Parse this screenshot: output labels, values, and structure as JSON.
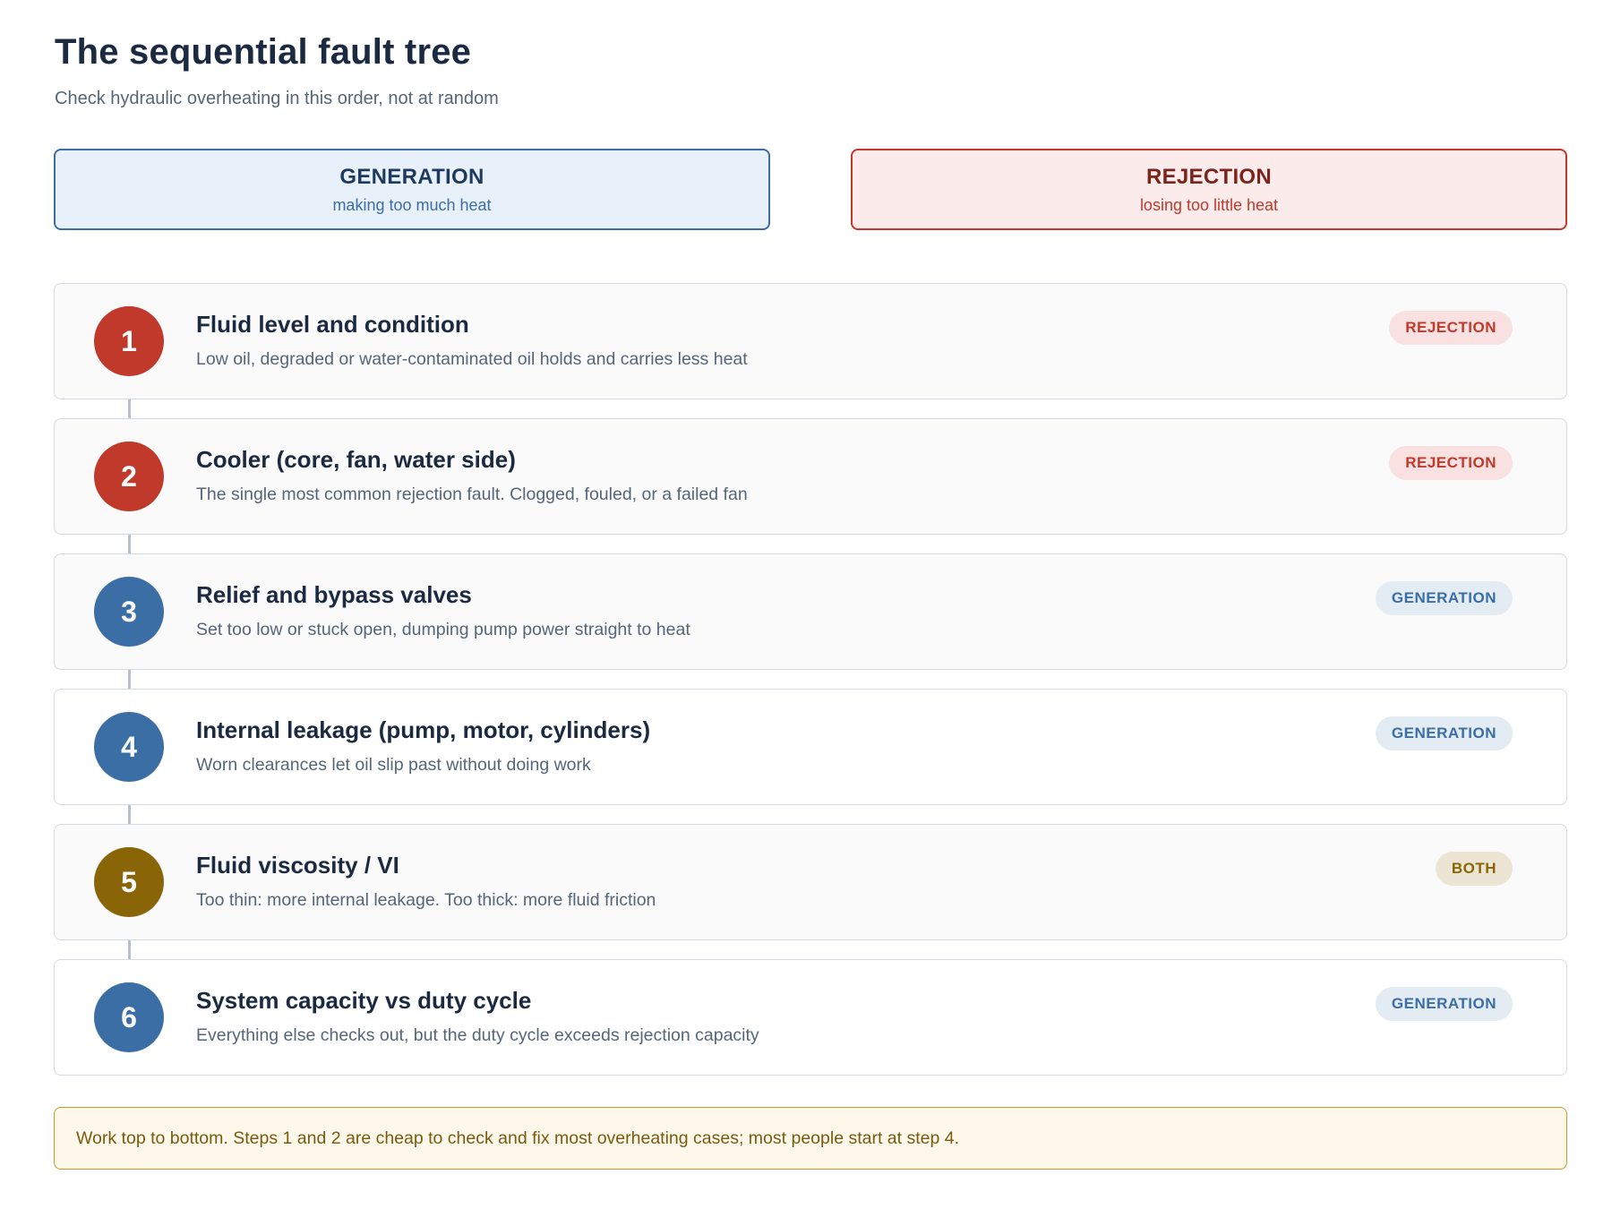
{
  "header": {
    "title": "The sequential fault tree",
    "subtitle": "Check hydraulic overheating in this order, not at random"
  },
  "legend": {
    "generation": {
      "title": "GENERATION",
      "subtitle": "making too much heat",
      "color": "#3a6ea5"
    },
    "rejection": {
      "title": "REJECTION",
      "subtitle": "losing too little heat",
      "color": "#c0392b"
    }
  },
  "steps": [
    {
      "number": "1",
      "title": "Fluid level and condition",
      "description": "Low oil, degraded or water-contaminated oil holds and carries less heat",
      "badge": "REJECTION"
    },
    {
      "number": "2",
      "title": "Cooler (core, fan, water side)",
      "description": "The single most common rejection fault. Clogged, fouled, or a failed fan",
      "badge": "REJECTION"
    },
    {
      "number": "3",
      "title": "Relief and bypass valves",
      "description": "Set too low or stuck open, dumping pump power straight to heat",
      "badge": "GENERATION"
    },
    {
      "number": "4",
      "title": "Internal leakage (pump, motor, cylinders)",
      "description": "Worn clearances let oil slip past without doing work",
      "badge": "GENERATION"
    },
    {
      "number": "5",
      "title": "Fluid viscosity / VI",
      "description": "Too thin: more internal leakage. Too thick: more fluid friction",
      "badge": "BOTH"
    },
    {
      "number": "6",
      "title": "System capacity vs duty cycle",
      "description": "Everything else checks out, but the duty cycle exceeds rejection capacity",
      "badge": "GENERATION"
    }
  ],
  "note": "Work top to bottom. Steps 1 and 2 are cheap to check and fix most overheating cases; most people start at step 4.",
  "colors": {
    "both": "#8a6508"
  }
}
